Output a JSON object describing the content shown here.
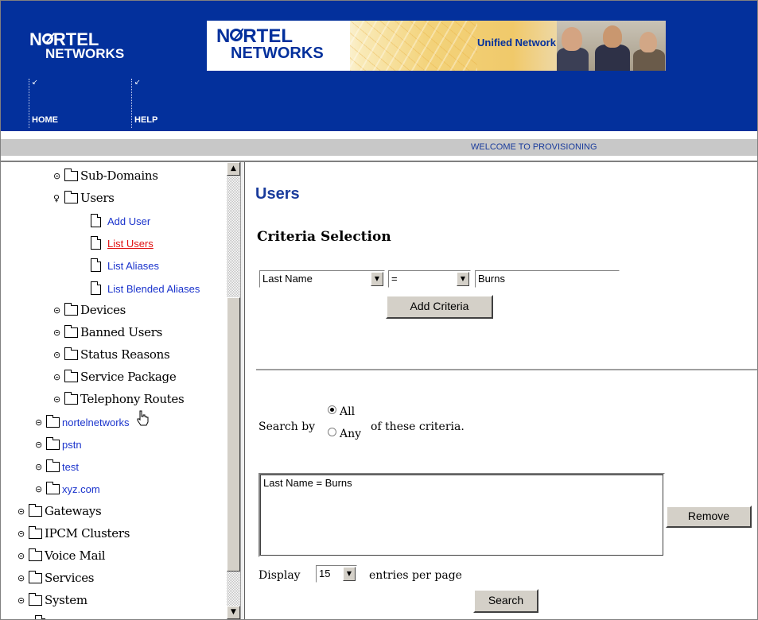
{
  "header": {
    "logo_main": "NRTEL",
    "logo_sub": "NETWORKS",
    "banner_logo_main": "NRTEL",
    "banner_logo_sub": "NETWORKS",
    "banner_tagline": "Unified Network",
    "nav": [
      {
        "label": "HOME",
        "icon": "arrow-icon"
      },
      {
        "label": "HELP",
        "icon": "arrow-icon"
      }
    ],
    "welcome": "WELCOME TO PROVISIONING",
    "brand_color": "#03309c"
  },
  "tree": {
    "items": [
      {
        "label": "Sub-Domains",
        "expanded": false
      },
      {
        "label": "Users",
        "expanded": true
      },
      {
        "label": "Add User"
      },
      {
        "label": "List Users",
        "active": true
      },
      {
        "label": "List Aliases"
      },
      {
        "label": "List Blended Aliases"
      },
      {
        "label": "Devices",
        "expanded": false
      },
      {
        "label": "Banned Users",
        "expanded": false
      },
      {
        "label": "Status Reasons",
        "expanded": false
      },
      {
        "label": "Service Package",
        "expanded": false
      },
      {
        "label": "Telephony Routes",
        "expanded": false
      },
      {
        "label": "nortelnetworks",
        "expanded": false
      },
      {
        "label": "pstn",
        "expanded": false
      },
      {
        "label": "test",
        "expanded": false
      },
      {
        "label": "xyz.com",
        "expanded": false
      },
      {
        "label": "Gateways",
        "expanded": false
      },
      {
        "label": "IPCM Clusters",
        "expanded": false
      },
      {
        "label": "Voice Mail",
        "expanded": false
      },
      {
        "label": "Services",
        "expanded": false
      },
      {
        "label": "System",
        "expanded": false
      }
    ],
    "link_color": "#1a33cc",
    "active_color": "#e01010"
  },
  "main": {
    "title": "Users",
    "section_title": "Criteria Selection",
    "field_select": "Last Name",
    "operator_select": "=",
    "value_input": "Burns",
    "add_button": "Add Criteria",
    "search_by_label": "Search by",
    "radio_all": "All",
    "radio_any": "Any",
    "radio_selected": "All",
    "criteria_suffix": "of these criteria.",
    "criteria_list": [
      "Last Name = Burns"
    ],
    "remove_button": "Remove",
    "display_label": "Display",
    "display_select": "15",
    "entries_label": "entries per page",
    "search_button": "Search"
  }
}
